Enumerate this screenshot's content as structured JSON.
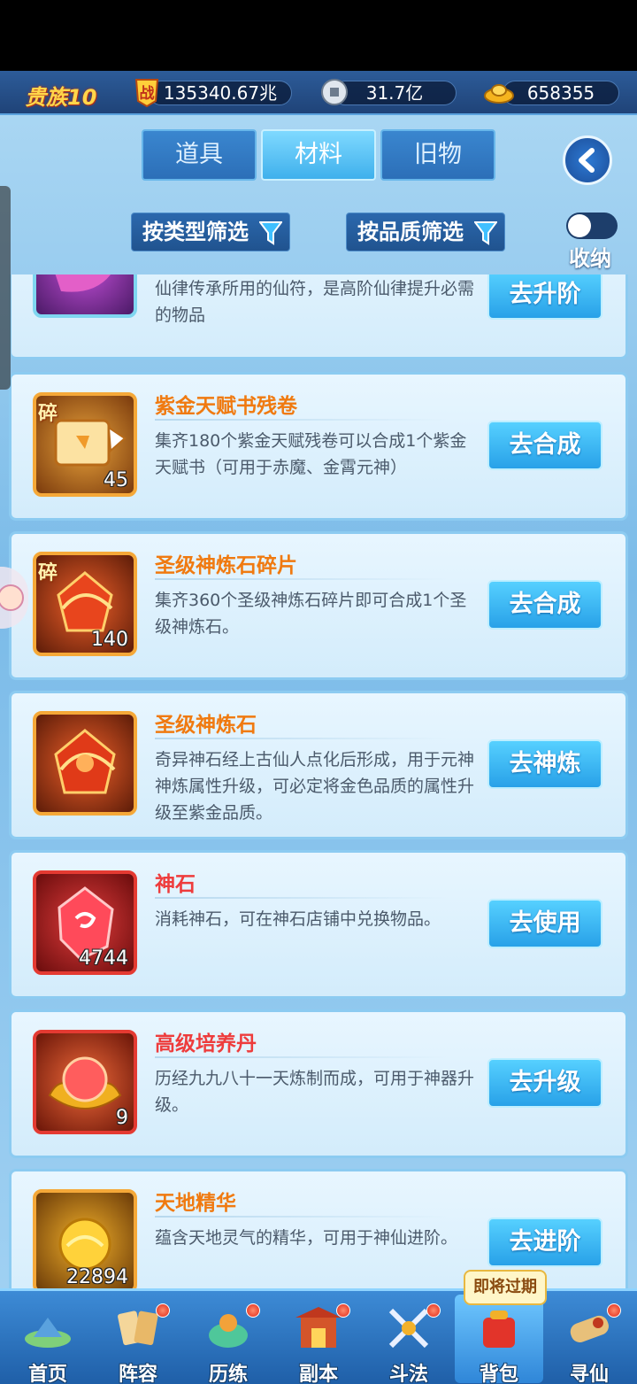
{
  "top_bar": {
    "vip_label": "贵族10",
    "power_value": "135340.67兆",
    "coins_value": "31.7亿",
    "gold_value": "658355"
  },
  "tabs": [
    {
      "label": "道具",
      "active": false
    },
    {
      "label": "材料",
      "active": true
    },
    {
      "label": "旧物",
      "active": false
    }
  ],
  "filters": {
    "by_type": "按类型筛选",
    "by_quality": "按品质筛选",
    "collapse_label": "收纳"
  },
  "items": [
    {
      "title": "",
      "desc": "仙律传承所用的仙符，是高阶仙律提升必需的物品",
      "count": "",
      "button": "去升阶"
    },
    {
      "title": "紫金天赋书残卷",
      "desc": "集齐180个紫金天赋残卷可以合成1个紫金天赋书（可用于赤魔、金霄元神）",
      "count": "45",
      "shard": "碎",
      "button": "去合成"
    },
    {
      "title": "圣级神炼石碎片",
      "desc": "集齐360个圣级神炼石碎片即可合成1个圣级神炼石。",
      "count": "140",
      "shard": "碎",
      "button": "去合成"
    },
    {
      "title": "圣级神炼石",
      "desc": "奇异神石经上古仙人点化后形成，用于元神神炼属性升级，可必定将金色品质的属性升级至紫金品质。",
      "count": "",
      "button": "去神炼"
    },
    {
      "title": "神石",
      "desc": "消耗神石，可在神石店铺中兑换物品。",
      "count": "4744",
      "button": "去使用"
    },
    {
      "title": "高级培养丹",
      "desc": "历经九九八十一天炼制而成，可用于神器升级。",
      "count": "9",
      "button": "去升级"
    },
    {
      "title": "天地精华",
      "desc": "蕴含天地灵气的精华，可用于神仙进阶。",
      "count": "22894",
      "button": "去进阶"
    }
  ],
  "expire_tag": "即将过期",
  "bottom_nav": [
    {
      "label": "首页",
      "icon": "home-icon",
      "dot": false
    },
    {
      "label": "阵容",
      "icon": "lineup-icon",
      "dot": true
    },
    {
      "label": "历练",
      "icon": "training-icon",
      "dot": true
    },
    {
      "label": "副本",
      "icon": "dungeon-icon",
      "dot": true
    },
    {
      "label": "斗法",
      "icon": "battle-icon",
      "dot": true
    },
    {
      "label": "背包",
      "icon": "backpack-icon",
      "dot": false,
      "active": true
    },
    {
      "label": "寻仙",
      "icon": "seek-icon",
      "dot": true
    }
  ]
}
